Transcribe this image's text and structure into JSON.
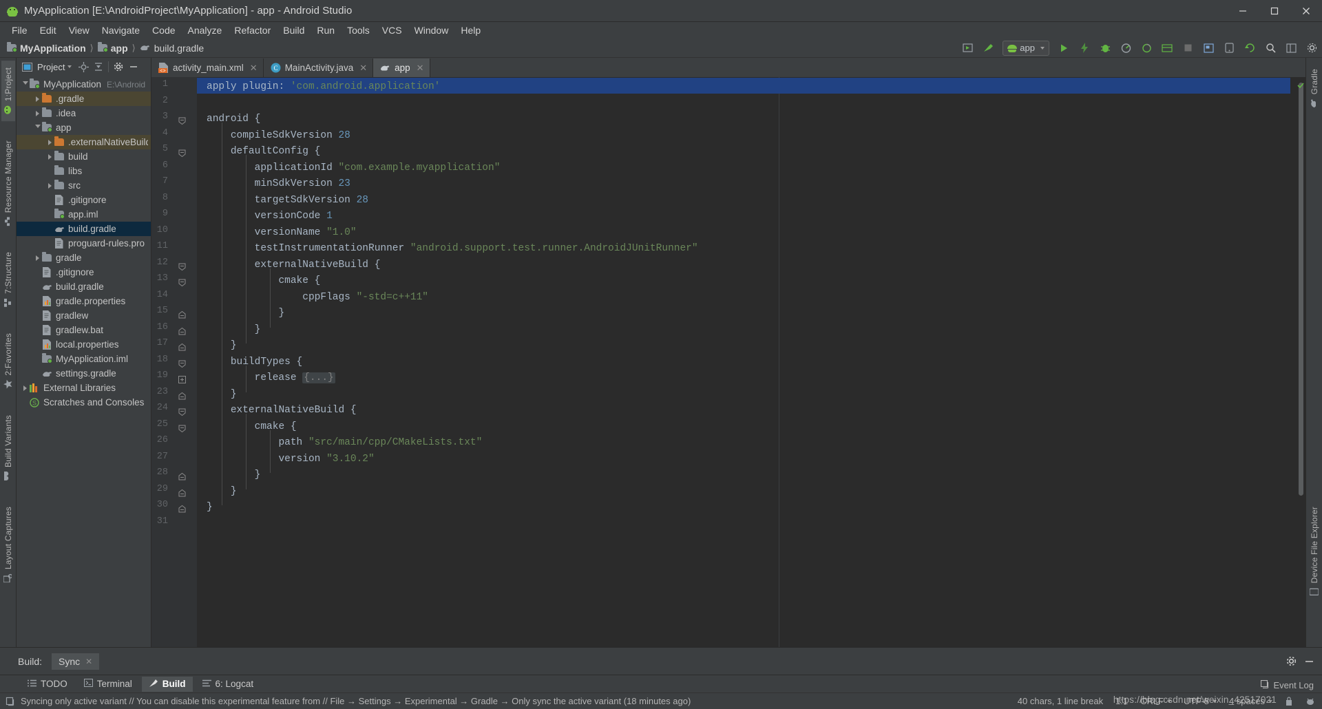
{
  "window": {
    "title": "MyApplication [E:\\AndroidProject\\MyApplication] - app - Android Studio",
    "minimize": "─",
    "maximize": "☐",
    "close": "✕"
  },
  "menubar": [
    {
      "label": "File"
    },
    {
      "label": "Edit"
    },
    {
      "label": "View"
    },
    {
      "label": "Navigate"
    },
    {
      "label": "Code"
    },
    {
      "label": "Analyze"
    },
    {
      "label": "Refactor"
    },
    {
      "label": "Build"
    },
    {
      "label": "Run"
    },
    {
      "label": "Tools"
    },
    {
      "label": "VCS"
    },
    {
      "label": "Window"
    },
    {
      "label": "Help"
    }
  ],
  "navbar": {
    "breadcrumb": [
      "MyApplication",
      "app",
      "build.gradle"
    ],
    "run_config": "app",
    "icons": [
      "preview-icon",
      "make-project-icon",
      "run-icon",
      "apply-changes-icon",
      "debug-icon",
      "profile-icon",
      "attach-debugger-icon",
      "sdk-manager-icon",
      "avd-manager-icon",
      "stop-icon",
      "layout-inspector-icon",
      "device-explorer-icon",
      "sync-gradle-icon",
      "search-icon",
      "project-structure-icon",
      "settings-icon"
    ]
  },
  "left_strip": [
    {
      "label": "1:Project",
      "icon": "project-icon",
      "active": true
    },
    {
      "label": "Resource Manager",
      "icon": "resource-manager-icon",
      "active": false
    },
    {
      "label": "7:Structure",
      "icon": "structure-icon",
      "active": false
    },
    {
      "label": "2:Favorites",
      "icon": "favorites-star-icon",
      "active": false
    },
    {
      "label": "Build Variants",
      "icon": "build-variants-icon",
      "active": false
    },
    {
      "label": "Layout Captures",
      "icon": "layout-captures-icon",
      "active": false
    }
  ],
  "right_strip": [
    {
      "label": "Gradle",
      "icon": "gradle-icon"
    },
    {
      "label": "Device File Explorer",
      "icon": "device-file-explorer-icon"
    }
  ],
  "project_panel": {
    "title": "Project",
    "header_icons": [
      "project-view-select-icon",
      "locate-icon",
      "collapse-all-icon",
      "settings-icon",
      "hide-icon"
    ],
    "tree": [
      {
        "label": "MyApplication",
        "path": "E:\\Android",
        "depth": 0,
        "arrow": "open",
        "icon": "module-folder-icon",
        "state": "none"
      },
      {
        "label": ".gradle",
        "depth": 1,
        "arrow": "closed",
        "icon": "folder-orange-icon",
        "state": "hl"
      },
      {
        "label": ".idea",
        "depth": 1,
        "arrow": "closed",
        "icon": "folder-icon",
        "state": "none"
      },
      {
        "label": "app",
        "depth": 1,
        "arrow": "open",
        "icon": "module-folder-icon",
        "state": "none"
      },
      {
        "label": ".externalNativeBuild",
        "depth": 2,
        "arrow": "closed",
        "icon": "folder-orange-icon",
        "state": "hl"
      },
      {
        "label": "build",
        "depth": 2,
        "arrow": "closed",
        "icon": "folder-icon",
        "state": "none"
      },
      {
        "label": "libs",
        "depth": 2,
        "arrow": "none",
        "icon": "folder-icon",
        "state": "none"
      },
      {
        "label": "src",
        "depth": 2,
        "arrow": "closed",
        "icon": "folder-icon",
        "state": "none"
      },
      {
        "label": ".gitignore",
        "depth": 2,
        "arrow": "none",
        "icon": "file-icon",
        "state": "none"
      },
      {
        "label": "app.iml",
        "depth": 2,
        "arrow": "none",
        "icon": "module-folder-icon",
        "state": "none"
      },
      {
        "label": "build.gradle",
        "depth": 2,
        "arrow": "none",
        "icon": "gradle-file-icon",
        "state": "sel"
      },
      {
        "label": "proguard-rules.pro",
        "depth": 2,
        "arrow": "none",
        "icon": "file-icon",
        "state": "none"
      },
      {
        "label": "gradle",
        "depth": 1,
        "arrow": "closed",
        "icon": "folder-icon",
        "state": "none"
      },
      {
        "label": ".gitignore",
        "depth": 1,
        "arrow": "none",
        "icon": "file-icon",
        "state": "none"
      },
      {
        "label": "build.gradle",
        "depth": 1,
        "arrow": "none",
        "icon": "gradle-file-icon",
        "state": "none"
      },
      {
        "label": "gradle.properties",
        "depth": 1,
        "arrow": "none",
        "icon": "properties-file-icon",
        "state": "none"
      },
      {
        "label": "gradlew",
        "depth": 1,
        "arrow": "none",
        "icon": "file-icon",
        "state": "none"
      },
      {
        "label": "gradlew.bat",
        "depth": 1,
        "arrow": "none",
        "icon": "file-icon",
        "state": "none"
      },
      {
        "label": "local.properties",
        "depth": 1,
        "arrow": "none",
        "icon": "properties-file-icon",
        "state": "none"
      },
      {
        "label": "MyApplication.iml",
        "depth": 1,
        "arrow": "none",
        "icon": "module-folder-icon",
        "state": "none"
      },
      {
        "label": "settings.gradle",
        "depth": 1,
        "arrow": "none",
        "icon": "gradle-file-icon",
        "state": "none"
      },
      {
        "label": "External Libraries",
        "depth": 0,
        "arrow": "closed",
        "icon": "libraries-icon",
        "state": "none"
      },
      {
        "label": "Scratches and Consoles",
        "depth": 0,
        "arrow": "none",
        "icon": "scratches-icon",
        "state": "none"
      }
    ]
  },
  "editor": {
    "tabs": [
      {
        "label": "activity_main.xml",
        "icon": "xml-layout-icon",
        "active": false,
        "close": "✕"
      },
      {
        "label": "MainActivity.java",
        "icon": "java-class-icon",
        "active": false,
        "close": "✕"
      },
      {
        "label": "app",
        "icon": "gradle-file-icon",
        "active": true,
        "close": "✕"
      }
    ],
    "lines": [
      {
        "no": 1,
        "fold": "none",
        "text": "apply plugin: 'com.android.application'",
        "selected": true
      },
      {
        "no": 2,
        "fold": "none",
        "text": ""
      },
      {
        "no": 3,
        "fold": "collapse",
        "text": "android {"
      },
      {
        "no": 4,
        "fold": "none",
        "text": "    compileSdkVersion 28"
      },
      {
        "no": 5,
        "fold": "collapse",
        "text": "    defaultConfig {"
      },
      {
        "no": 6,
        "fold": "none",
        "text": "        applicationId \"com.example.myapplication\""
      },
      {
        "no": 7,
        "fold": "none",
        "text": "        minSdkVersion 23"
      },
      {
        "no": 8,
        "fold": "none",
        "text": "        targetSdkVersion 28"
      },
      {
        "no": 9,
        "fold": "none",
        "text": "        versionCode 1"
      },
      {
        "no": 10,
        "fold": "none",
        "text": "        versionName \"1.0\""
      },
      {
        "no": 11,
        "fold": "none",
        "text": "        testInstrumentationRunner \"android.support.test.runner.AndroidJUnitRunner\""
      },
      {
        "no": 12,
        "fold": "collapse",
        "text": "        externalNativeBuild {"
      },
      {
        "no": 13,
        "fold": "collapse",
        "text": "            cmake {"
      },
      {
        "no": 14,
        "fold": "none",
        "text": "                cppFlags \"-std=c++11\""
      },
      {
        "no": 15,
        "fold": "end",
        "text": "            }"
      },
      {
        "no": 16,
        "fold": "end",
        "text": "        }"
      },
      {
        "no": 17,
        "fold": "end",
        "text": "    }"
      },
      {
        "no": 18,
        "fold": "collapse",
        "text": "    buildTypes {"
      },
      {
        "no": 19,
        "fold": "expand",
        "text": "        release {...}",
        "folded": true
      },
      {
        "no": 23,
        "fold": "end",
        "text": "    }"
      },
      {
        "no": 24,
        "fold": "collapse",
        "text": "    externalNativeBuild {"
      },
      {
        "no": 25,
        "fold": "collapse",
        "text": "        cmake {"
      },
      {
        "no": 26,
        "fold": "none",
        "text": "            path \"src/main/cpp/CMakeLists.txt\""
      },
      {
        "no": 27,
        "fold": "none",
        "text": "            version \"3.10.2\""
      },
      {
        "no": 28,
        "fold": "end",
        "text": "        }"
      },
      {
        "no": 29,
        "fold": "end",
        "text": "    }"
      },
      {
        "no": 30,
        "fold": "end",
        "text": "}"
      },
      {
        "no": 31,
        "fold": "none",
        "text": ""
      }
    ]
  },
  "build_panel": {
    "label": "Build:",
    "tab": "Sync",
    "close": "✕",
    "settings_icon": "gear-icon",
    "hide_icon": "minimize-icon"
  },
  "bottom_tabs": [
    {
      "label": "TODO",
      "icon": "todo-icon",
      "active": false
    },
    {
      "label": "Terminal",
      "icon": "terminal-icon",
      "active": false
    },
    {
      "label": "Build",
      "icon": "build-hammer-icon",
      "active": true
    },
    {
      "label": "6: Logcat",
      "icon": "logcat-icon",
      "active": false
    }
  ],
  "statusbar": {
    "message": "Syncing only active variant // You can disable this experimental feature from // File → Settings → Experimental → Gradle → Only sync the active variant (18 minutes ago)",
    "chars": "40 chars, 1 line break",
    "position": "1:1",
    "line_sep": "CRLF",
    "encoding": "UTF-8",
    "indent": "4 spaces",
    "event_log": "Event Log",
    "watermark": "https://blog.csdn.net/weixin_42517021"
  },
  "colors": {
    "accent_green": "#62b543",
    "selection_blue": "#214283",
    "tree_selection": "#0d293e",
    "string_green": "#6a8759",
    "number_blue": "#6897bb",
    "code_fg": "#a9b7c6",
    "panel_bg": "#3c3f41",
    "editor_bg": "#2b2b2b"
  }
}
